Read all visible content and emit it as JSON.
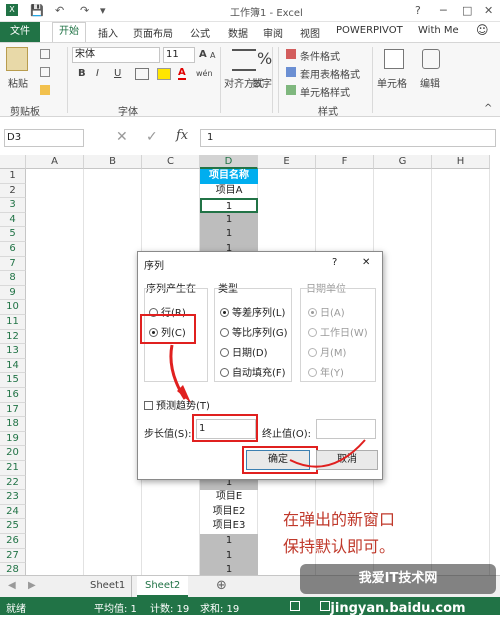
{
  "window": {
    "title": "工作簿1 - Excel",
    "help": "?",
    "min": "─",
    "max": "□",
    "close": "✕"
  },
  "quick_access": [
    "💾",
    "↶",
    "↷",
    "▾"
  ],
  "tabs": [
    "文件",
    "开始",
    "插入",
    "页面布局",
    "公式",
    "数据",
    "审阅",
    "视图",
    "POWERPIVOT",
    "With Me"
  ],
  "account_icon": "☺",
  "ribbon": {
    "clipboard": {
      "paste": "粘贴",
      "label": "剪贴板"
    },
    "font": {
      "name": "宋体",
      "size": "11",
      "bold": "B",
      "italic": "I",
      "underline": "U",
      "grow": "A",
      "shrink": "A",
      "color_a": "A",
      "wen": "wén",
      "label": "字体"
    },
    "alignment": {
      "label": "对齐方式"
    },
    "number": {
      "label": "数字",
      "percent": "%"
    },
    "styles": {
      "cond": "条件格式",
      "table": "套用表格格式",
      "cell": "单元格样式",
      "label": "样式"
    },
    "cells": {
      "label": "单元格"
    },
    "editing": {
      "label": "编辑"
    }
  },
  "formula_bar": {
    "namebox": "D3",
    "fx": "fx",
    "cancel": "✕",
    "enter": "✓",
    "value": "1"
  },
  "columns": [
    "A",
    "B",
    "C",
    "D",
    "E",
    "F",
    "G",
    "H"
  ],
  "rows": [
    "1",
    "2",
    "3",
    "4",
    "5",
    "6",
    "7",
    "8",
    "9",
    "10",
    "11",
    "12",
    "13",
    "14",
    "15",
    "16",
    "17",
    "18",
    "19",
    "20",
    "21",
    "22",
    "23",
    "24",
    "25",
    "26",
    "27",
    "28"
  ],
  "column_d": {
    "1": "项目名称",
    "2": "项目A",
    "3": "1",
    "4": "1",
    "5": "1",
    "6": "1",
    "7": "1",
    "22": "1",
    "23": "项目E",
    "24": "项目E2",
    "25": "项目E3",
    "26": "1",
    "27": "1",
    "28": "1"
  },
  "dialog": {
    "title": "序列",
    "help": "?",
    "close": "✕",
    "series_in": {
      "label": "序列产生在",
      "rows": "行(R)",
      "cols": "列(C)"
    },
    "type": {
      "label": "类型",
      "linear": "等差序列(L)",
      "growth": "等比序列(G)",
      "date": "日期(D)",
      "autofill": "自动填充(F)"
    },
    "date_unit": {
      "label": "日期单位",
      "day": "日(A)",
      "weekday": "工作日(W)",
      "month": "月(M)",
      "year": "年(Y)"
    },
    "trend": "预测趋势(T)",
    "step": {
      "label": "步长值(S):",
      "value": "1"
    },
    "stop": {
      "label": "终止值(O):",
      "value": ""
    },
    "ok": "确定",
    "cancel": "取消"
  },
  "sheets": [
    "Sheet1",
    "Sheet2"
  ],
  "add_sheet": "⊕",
  "status": {
    "ready": "就绪",
    "average": "平均值: 1",
    "count": "计数: 19",
    "sum": "求和: 19"
  },
  "annotation": [
    "在弹出的新窗口",
    "保持默认即可。"
  ],
  "watermark": "我爱IT技术网 jingyan.baidu.com",
  "colors": {
    "excel_green": "#217346",
    "selection": "#bdbdbd",
    "highlight": "#e0201f",
    "annotation": "#c0392b"
  }
}
